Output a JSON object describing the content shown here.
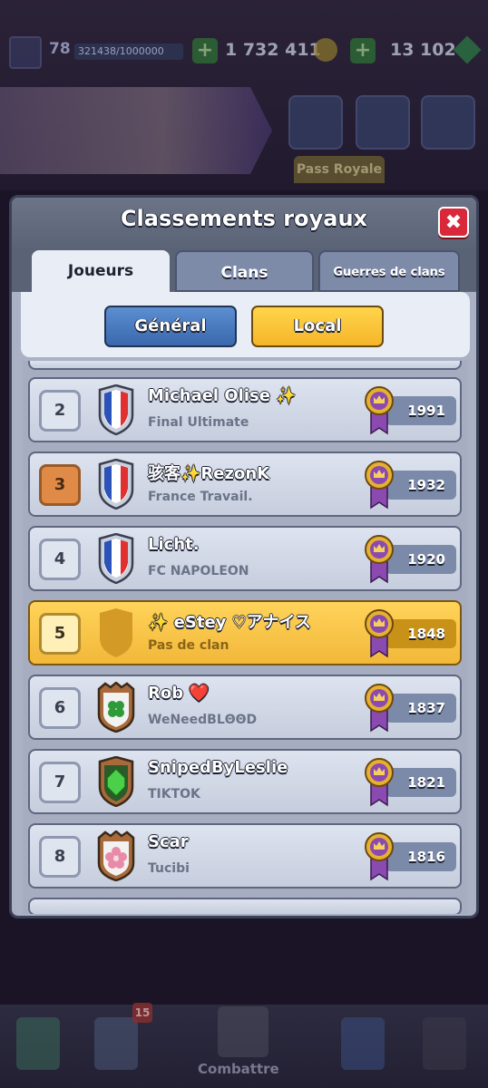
{
  "topbar": {
    "level": "78",
    "xp_text": "321438/1000000",
    "gold": "1 732 411",
    "gems": "13 102"
  },
  "pass_label": "Pass Royale",
  "modal": {
    "title": "Classements royaux",
    "close_symbol": "✖",
    "tabs": [
      "Joueurs",
      "Clans",
      "Guerres de clans"
    ],
    "filters": [
      "Général",
      "Local"
    ]
  },
  "rows": [
    {
      "rank": "2",
      "name": "Michael Olise ✨",
      "clan": "Final Ultimate",
      "trophies": "1991",
      "badge": "flag-fr"
    },
    {
      "rank": "3",
      "name": "骇客✨RezonK",
      "clan": "France Travail.",
      "trophies": "1932",
      "badge": "flag-fr"
    },
    {
      "rank": "4",
      "name": "Licht.",
      "clan": "FC NAPOLEON",
      "trophies": "1920",
      "badge": "flag-fr"
    },
    {
      "rank": "5",
      "name": "✨ eStey ♡アナイス",
      "clan": "Pas de clan",
      "trophies": "1848",
      "badge": "no-clan"
    },
    {
      "rank": "6",
      "name": "Rob ❤️",
      "clan": "WeNeedBLΘΘD",
      "trophies": "1837",
      "badge": "clover"
    },
    {
      "rank": "7",
      "name": "SnipedByLeslie",
      "clan": "TIKTOK",
      "trophies": "1821",
      "badge": "emerald"
    },
    {
      "rank": "8",
      "name": "Scar",
      "clan": "Tucibi",
      "trophies": "1816",
      "badge": "blossom"
    }
  ],
  "bottom_nav": {
    "battle_label": "Combattre",
    "cards_badge": "15"
  },
  "colors": {
    "accent_gold": "#f5b52a",
    "accent_blue": "#3a68ae",
    "close_red": "#d8283a",
    "medal_purple": "#8a4ab0"
  }
}
